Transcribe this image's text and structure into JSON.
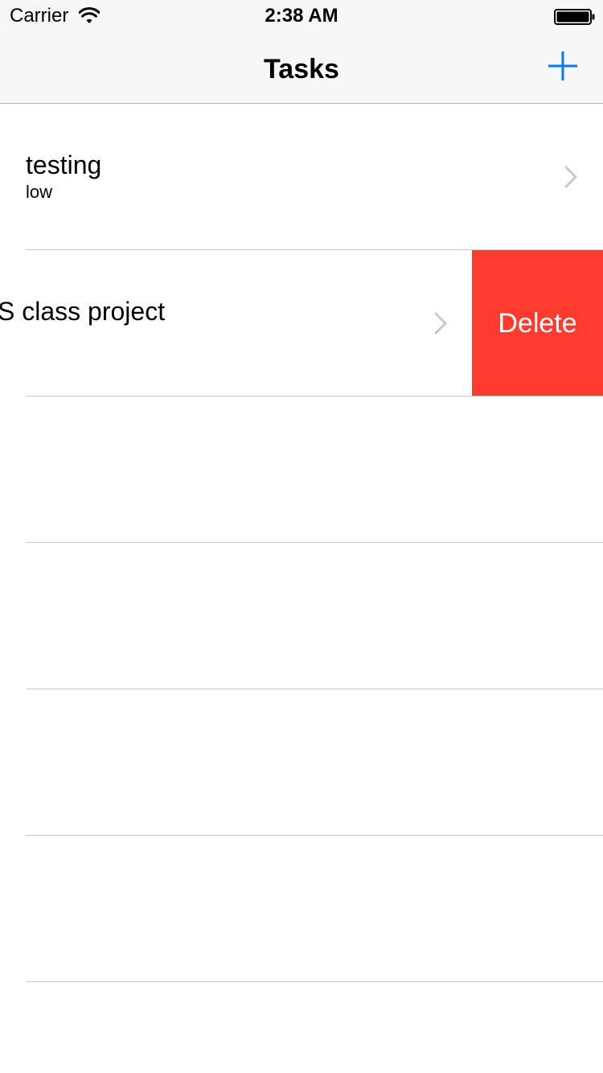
{
  "status_bar": {
    "carrier": "Carrier",
    "time": "2:38 AM",
    "wifi_icon": "wifi-icon",
    "battery_icon": "battery-icon"
  },
  "nav": {
    "title": "Tasks",
    "add_icon": "plus-icon",
    "tint_color": "#007aff"
  },
  "tasks": [
    {
      "title": "testing",
      "subtitle": "low",
      "chevron_icon": "chevron-right-icon"
    },
    {
      "title": "S class project",
      "subtitle": "",
      "chevron_icon": "chevron-right-icon",
      "swiped": true
    }
  ],
  "delete_action": {
    "label": "Delete",
    "color": "#ff3b30"
  }
}
